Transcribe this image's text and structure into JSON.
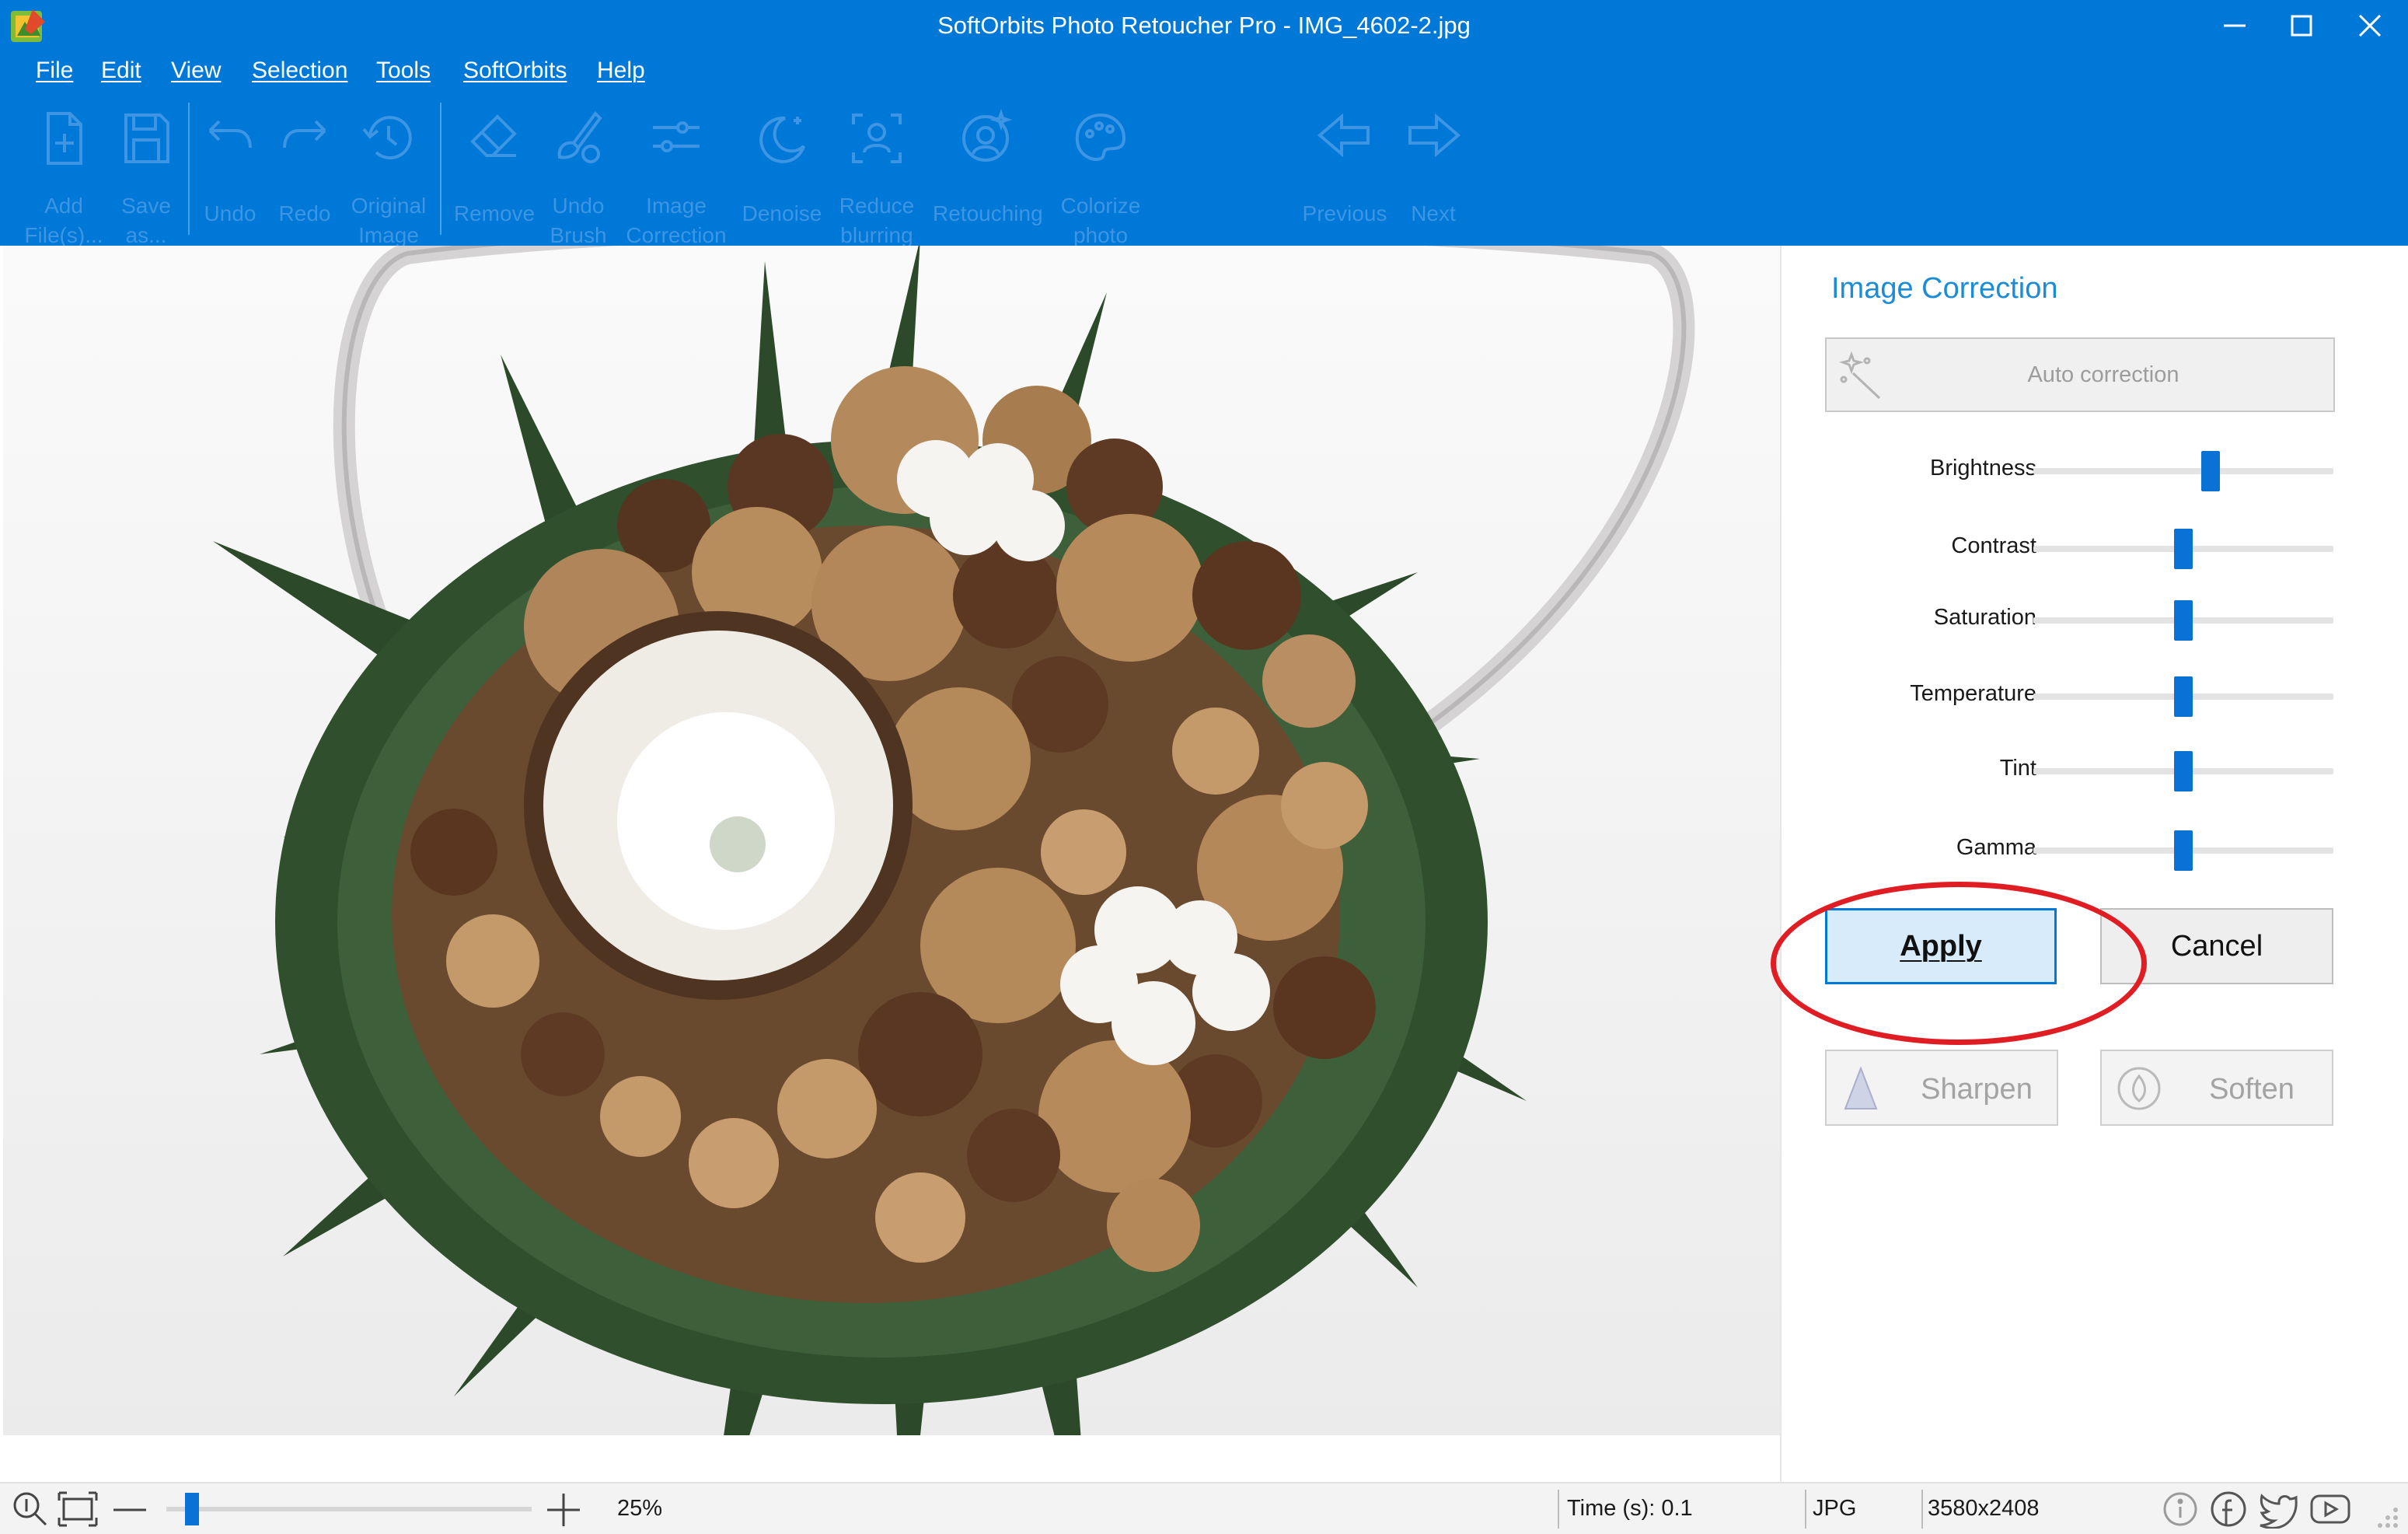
{
  "window": {
    "title": "SoftOrbits Photo Retoucher Pro - IMG_4602-2.jpg"
  },
  "menu": [
    "File",
    "Edit",
    "View",
    "Selection",
    "Tools",
    "SoftOrbits",
    "Help"
  ],
  "toolbar": {
    "add_files": [
      "Add",
      "File(s)..."
    ],
    "save_as": [
      "Save",
      "as..."
    ],
    "undo": [
      "Undo"
    ],
    "redo": [
      "Redo"
    ],
    "original_image": [
      "Original",
      "Image"
    ],
    "remove": [
      "Remove"
    ],
    "undo_brush": [
      "Undo",
      "Brush"
    ],
    "image_correction": [
      "Image",
      "Correction"
    ],
    "denoise": [
      "Denoise"
    ],
    "reduce_blurring": [
      "Reduce",
      "blurring"
    ],
    "retouching": [
      "Retouching"
    ],
    "colorize_photo": [
      "Colorize",
      "photo"
    ],
    "previous": [
      "Previous"
    ],
    "next": [
      "Next"
    ]
  },
  "panel": {
    "title": "Image Correction",
    "auto_correction": "Auto correction",
    "sliders": [
      {
        "label": "Brightness",
        "value": 0.59
      },
      {
        "label": "Contrast",
        "value": 0.5
      },
      {
        "label": "Saturation",
        "value": 0.5
      },
      {
        "label": "Temperature",
        "value": 0.5
      },
      {
        "label": "Tint",
        "value": 0.5
      },
      {
        "label": "Gamma",
        "value": 0.5
      }
    ],
    "apply": "Apply",
    "cancel": "Cancel",
    "sharpen": "Sharpen",
    "soften": "Soften"
  },
  "status": {
    "zoom": "25%",
    "zoom_slider": 0.07,
    "time": "Time (s): 0.1",
    "format": "JPG",
    "dimensions": "3580x2408"
  },
  "colors": {
    "accent": "#0078d7",
    "highlight": "#e11d24",
    "slider": "#0a72d4"
  }
}
